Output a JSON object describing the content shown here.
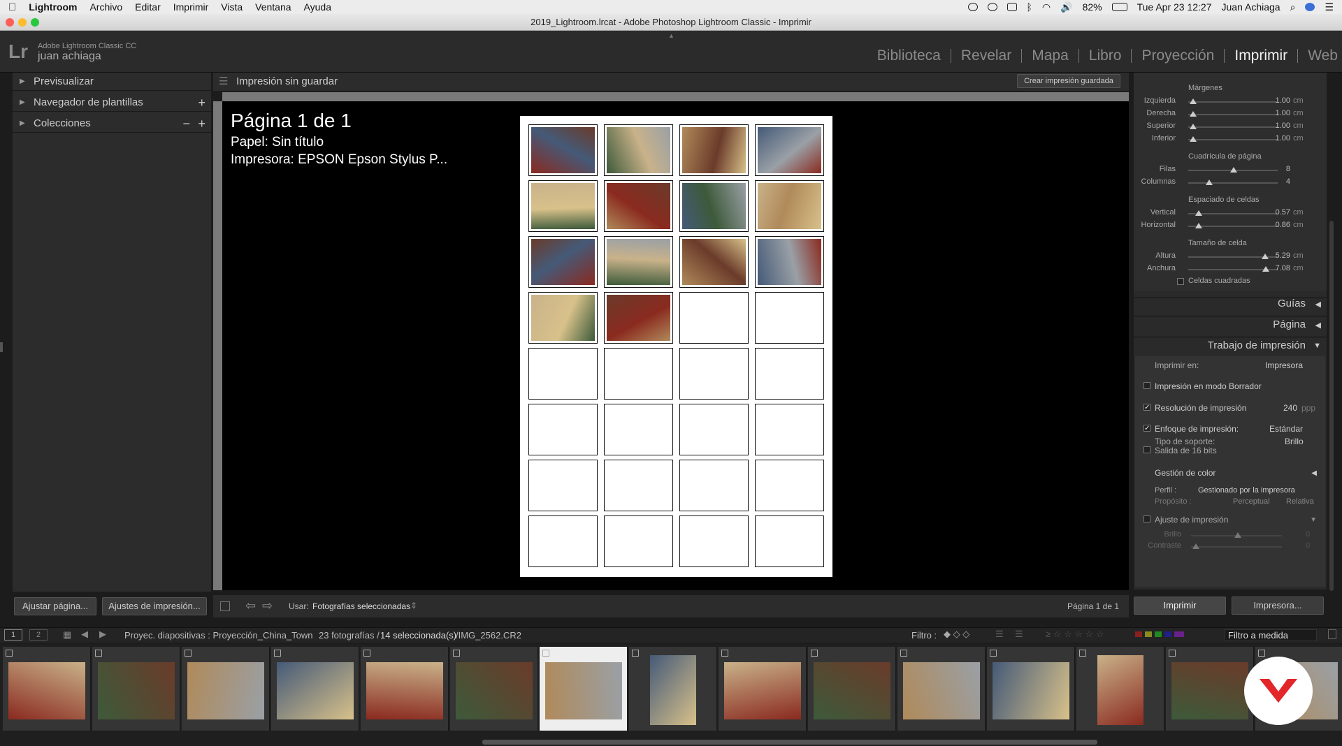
{
  "menubar": {
    "app": "Lightroom",
    "items": [
      "Archivo",
      "Editar",
      "Imprimir",
      "Vista",
      "Ventana",
      "Ayuda"
    ],
    "battery": "82%",
    "datetime": "Tue Apr 23  12:27",
    "user": "Juan Achiaga"
  },
  "window": {
    "title": "2019_Lightroom.lrcat - Adobe Photoshop Lightroom Classic - Imprimir"
  },
  "identity": {
    "logo": "Lr",
    "product": "Adobe Lightroom Classic CC",
    "user": "juan achiaga"
  },
  "modules": [
    "Biblioteca",
    "Revelar",
    "Mapa",
    "Libro",
    "Proyección",
    "Imprimir",
    "Web"
  ],
  "active_module": "Imprimir",
  "left_panel": {
    "sections": [
      {
        "label": "Previsualizar"
      },
      {
        "label": "Navegador de plantillas",
        "plus": "+"
      },
      {
        "label": "Colecciones",
        "minus": "−",
        "plus": "+"
      }
    ],
    "btn_page_setup": "Ajustar página...",
    "btn_print_settings": "Ajustes de impresión..."
  },
  "center": {
    "header_title": "Impresión sin guardar",
    "save_button": "Crear impresión guardada",
    "page_label": "Página 1 de 1",
    "paper_label": "Papel:  Sin título",
    "printer_label": "Impresora:  EPSON Epson Stylus P...",
    "use_label": "Usar:",
    "use_value": "Fotografías seleccionadas",
    "page_count": "Página 1 de 1",
    "grid": {
      "rows": 8,
      "cols": 4,
      "filled": 14
    }
  },
  "right_panel": {
    "margins_title": "Márgenes",
    "margins": [
      {
        "label": "Izquierda",
        "value": "1.00",
        "unit": "cm"
      },
      {
        "label": "Derecha",
        "value": "1.00",
        "unit": "cm"
      },
      {
        "label": "Superior",
        "value": "1.00",
        "unit": "cm"
      },
      {
        "label": "Inferior",
        "value": "1.00",
        "unit": "cm"
      }
    ],
    "grid_title": "Cuadrícula de página",
    "grid": [
      {
        "label": "Filas",
        "value": "8"
      },
      {
        "label": "Columnas",
        "value": "4"
      }
    ],
    "spacing_title": "Espaciado de celdas",
    "spacing": [
      {
        "label": "Vertical",
        "value": "0.57",
        "unit": "cm"
      },
      {
        "label": "Horizontal",
        "value": "0.86",
        "unit": "cm"
      }
    ],
    "cellsize_title": "Tamaño de celda",
    "cellsize": [
      {
        "label": "Altura",
        "value": "5.29",
        "unit": "cm"
      },
      {
        "label": "Anchura",
        "value": "7.08",
        "unit": "cm"
      }
    ],
    "square_cells": "Celdas cuadradas",
    "guides": "Guías",
    "page": "Página",
    "print_job": "Trabajo de impresión",
    "print_to_label": "Imprimir en:",
    "print_to_value": "Impresora",
    "draft_mode": "Impresión en modo Borrador",
    "print_resolution": "Resolución de impresión",
    "resolution_value": "240",
    "resolution_unit": "ppp",
    "sharpen_label": "Enfoque de impresión:",
    "sharpen_value": "Estándar",
    "media_label": "Tipo de soporte:",
    "media_value": "Brillo",
    "output16": "Salida de 16 bits",
    "color_mgmt": "Gestión de color",
    "profile_label": "Perfil :",
    "profile_value": "Gestionado por la impresora",
    "intent_label": "Propósito :",
    "intent_perceptual": "Perceptual",
    "intent_relative": "Relativa",
    "print_adjust": "Ajuste de impresión",
    "brightness_label": "Brillo",
    "contrast_label": "Contraste",
    "brightness_value": "0",
    "contrast_value": "0",
    "btn_print": "Imprimir",
    "btn_printer": "Impresora..."
  },
  "filmbar": {
    "view1": "1",
    "view2": "2",
    "source": "Proyec. diapositivas : Proyección_China_Town",
    "count": "23 fotografías /",
    "selected": "14 seleccionada(s)",
    "file": "/IMG_2562.CR2",
    "filter_label": "Filtro :",
    "filter_value": "Filtro a medida"
  },
  "colors": {
    "accent_photo_palette": [
      "#8a2a1f",
      "#3d5a3a",
      "#b08a5a",
      "#455a78",
      "#c9b28a",
      "#6a3b2a",
      "#9aa0a6",
      "#d8c18a"
    ]
  }
}
